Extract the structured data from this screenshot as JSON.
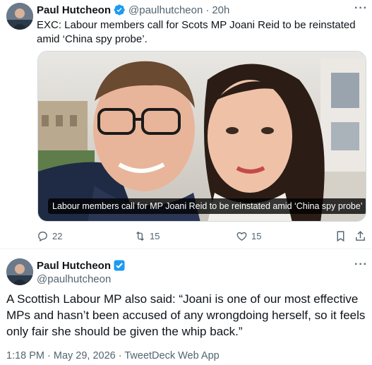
{
  "tweet": {
    "author_name": "Paul Hutcheon",
    "author_handle": "@paulhutcheon",
    "separator": "·",
    "time_ago": "20h",
    "text": "EXC: Labour members call for Scots MP Joani Reid to be reinstated amid ‘China spy probe’.",
    "media_caption": "Labour members call for MP Joani Reid to be reinstated amid ‘China spy probe’",
    "replies": "22",
    "retweets": "15",
    "likes": "15",
    "more_label": "···"
  },
  "reply": {
    "author_name": "Paul Hutcheon",
    "author_handle": "@paulhutcheon",
    "text": "A Scottish Labour MP also said: “Joani is one of our most effective MPs and hasn’t been accused of any wrongdoing herself, so it feels only fair she should be given the whip back.”",
    "timestamp": "1:18 PM · May 29, 2026 · TweetDeck Web App",
    "more_label": "···"
  },
  "icons": {
    "verified": "verified-badge-icon",
    "reply": "reply-icon",
    "retweet": "retweet-icon",
    "like": "heart-icon",
    "bookmark": "bookmark-icon",
    "share": "share-icon"
  },
  "colors": {
    "accent": "#1d9bf0",
    "secondary_text": "#536471",
    "primary_text": "#0f1419",
    "divider": "#eff3f4"
  }
}
